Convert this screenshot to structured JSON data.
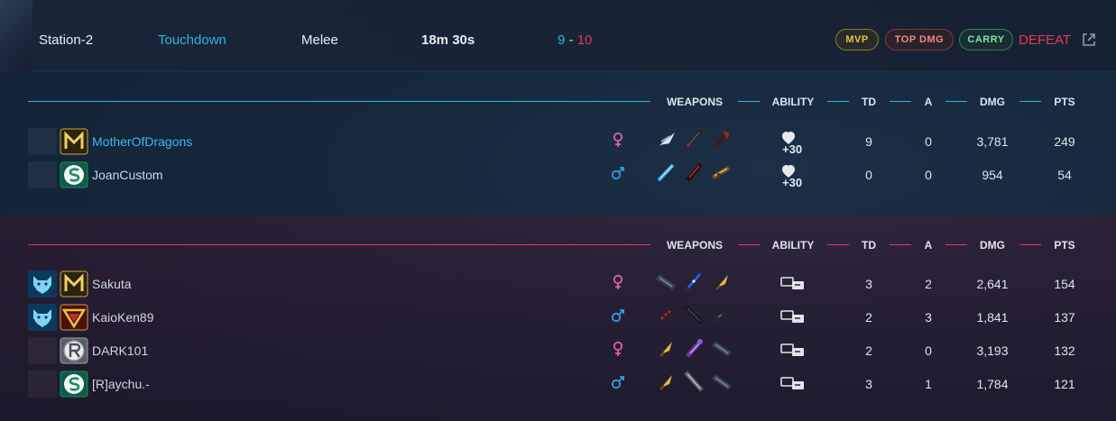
{
  "match": {
    "map": "Station-2",
    "mode": "Touchdown",
    "type": "Melee",
    "duration": "18m 30s",
    "score_blue": "9",
    "score_sep": " - ",
    "score_red": "10",
    "badges": {
      "mvp": "MVP",
      "top_dmg": "TOP DMG",
      "carry": "CARRY"
    },
    "result": "DEFEAT",
    "external_icon": "external-link-icon"
  },
  "columns": {
    "weapons": "WEAPONS",
    "ability": "ABILITY",
    "td": "TD",
    "a": "A",
    "dmg": "DMG",
    "pts": "PTS"
  },
  "colors": {
    "blue": "#2fb3e8",
    "red": "#e8365d",
    "female": "#e05fa8",
    "male": "#2fa0e0"
  },
  "teams": {
    "blue": {
      "players": [
        {
          "name": "MotherOfDragons",
          "is_self": true,
          "rank_icon": "none",
          "emblem": "m-emblem-icon",
          "gender": "female",
          "weapons": [
            "wing-blade-icon",
            "dark-blade-icon",
            "red-axe-icon"
          ],
          "ability": "heal-30-icon",
          "ability_text": "+30",
          "td": "9",
          "a": "0",
          "dmg": "3,781",
          "pts": "249"
        },
        {
          "name": "JoanCustom",
          "is_self": false,
          "rank_icon": "none",
          "emblem": "s-emblem-icon",
          "gender": "male",
          "weapons": [
            "blue-sword-icon",
            "red-blade-icon",
            "gold-gun-icon"
          ],
          "ability": "heal-30-icon",
          "ability_text": "+30",
          "td": "0",
          "a": "0",
          "dmg": "954",
          "pts": "54"
        }
      ]
    },
    "red": {
      "players": [
        {
          "name": "Sakuta",
          "is_self": false,
          "rank_icon": "wolf-rank-icon",
          "emblem": "m-emblem-icon",
          "gender": "female",
          "weapons": [
            "launcher-icon",
            "blue-rifle-icon",
            "gold-dagger-icon"
          ],
          "ability": "card-swap-icon",
          "td": "3",
          "a": "2",
          "dmg": "2,641",
          "pts": "154"
        },
        {
          "name": "KaioKen89",
          "is_self": false,
          "rank_icon": "wolf-rank-icon",
          "emblem": "triangle-emblem-icon",
          "gender": "male",
          "weapons": [
            "chain-blade-icon",
            "black-sword-icon",
            "shotgun-icon"
          ],
          "ability": "card-swap-icon",
          "td": "2",
          "a": "3",
          "dmg": "1,841",
          "pts": "137"
        },
        {
          "name": "DARK101",
          "is_self": false,
          "rank_icon": "none",
          "emblem": "r-emblem-icon",
          "gender": "female",
          "weapons": [
            "gold-dagger-icon",
            "purple-bat-icon",
            "launcher-icon"
          ],
          "ability": "card-swap-icon",
          "td": "2",
          "a": "0",
          "dmg": "3,193",
          "pts": "132"
        },
        {
          "name": "[R]aychu.-",
          "is_self": false,
          "rank_icon": "none",
          "emblem": "s-emblem-icon",
          "gender": "male",
          "weapons": [
            "gold-dagger-icon",
            "grey-sword-icon",
            "launcher-icon"
          ],
          "ability": "card-swap-icon",
          "td": "3",
          "a": "1",
          "dmg": "1,784",
          "pts": "121"
        }
      ]
    }
  }
}
